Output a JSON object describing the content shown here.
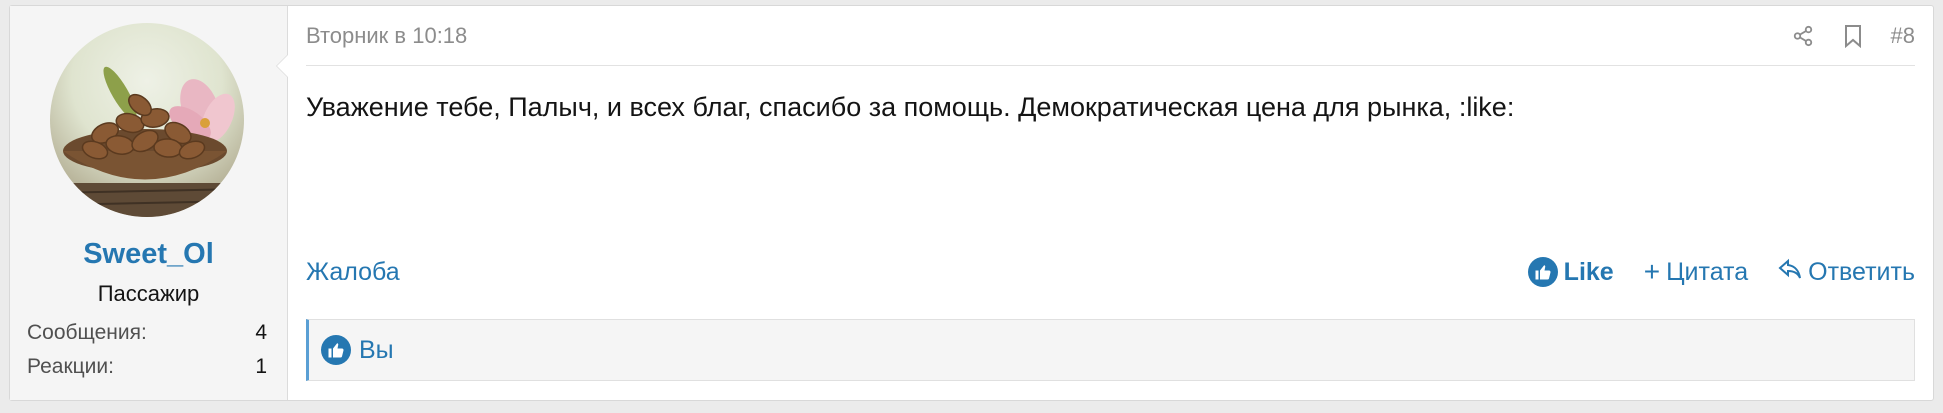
{
  "user": {
    "name": "Sweet_Ol",
    "title": "Пассажир",
    "stats": [
      {
        "label": "Сообщения:",
        "value": "4"
      },
      {
        "label": "Реакции:",
        "value": "1"
      }
    ],
    "avatar_icon": "almonds-bowl-avatar"
  },
  "post": {
    "date": "Вторник в 10:18",
    "number": "#8",
    "header_icons": [
      "share-icon",
      "bookmark-icon"
    ],
    "content": "Уважение тебе, Палыч, и всех благ, спасибо за помощь. Демократическая цена для рынка, :like:"
  },
  "footer": {
    "report": "Жалоба",
    "like": "Like",
    "quote": "Цитата",
    "reply": "Ответить"
  },
  "reactions": {
    "text": "Вы",
    "icon": "thumbs-up-icon"
  },
  "colors": {
    "accent": "#2577b1",
    "background": "#ebebeb",
    "sidebar": "#f5f5f5"
  }
}
